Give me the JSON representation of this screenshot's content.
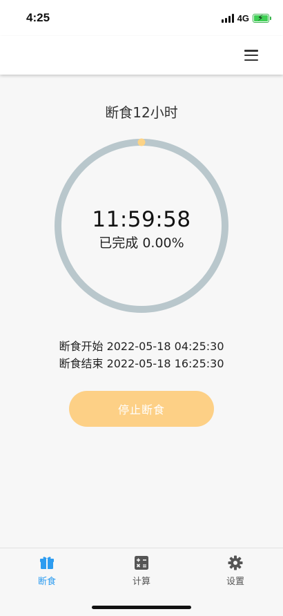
{
  "status_bar": {
    "time": "4:25",
    "network": "4G"
  },
  "fasting": {
    "plan_title": "断食12小时",
    "countdown": "11:59:58",
    "progress_text": "已完成 0.00%",
    "progress_fraction": 0.0,
    "start_line": "断食开始 2022-05-18 04:25:30",
    "end_line": "断食结束 2022-05-18 16:25:30",
    "stop_label": "停止断食"
  },
  "tabs": [
    {
      "label": "断食",
      "icon": "gift-icon",
      "active": true
    },
    {
      "label": "计算",
      "icon": "calculator-icon",
      "active": false
    },
    {
      "label": "设置",
      "icon": "gear-icon",
      "active": false
    }
  ],
  "colors": {
    "ring_track": "#b9c7cc",
    "progress_dot": "#fcd386",
    "button_bg": "#fdd086",
    "tab_active": "#2d9cf0",
    "tab_inactive": "#555555"
  }
}
